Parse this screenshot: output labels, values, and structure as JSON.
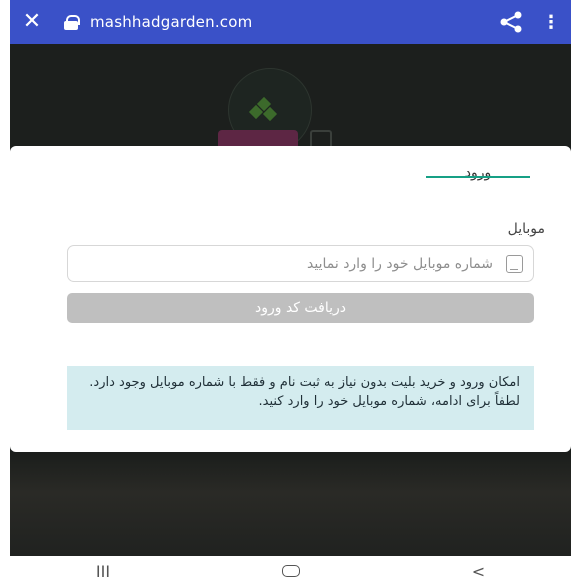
{
  "browser": {
    "url": "mashhadgarden.com",
    "close_glyph": "✕",
    "menu_glyph": "⋮"
  },
  "modal": {
    "tab_label": "ورود",
    "field_label": "موبایل",
    "mobile_placeholder": "شماره موبایل خود را وارد نمایید",
    "submit_label": "دریافت کد ورود",
    "notice_text": "امکان ورود و خرید بلیت بدون نیاز به ثبت نام و فقط با شماره موبایل وجود دارد. لطفاً برای ادامه، شماره موبایل خود را وارد کنید."
  },
  "navbar": {
    "recents_glyph": "III",
    "back_glyph": "<"
  },
  "colors": {
    "browser_bar": "#3a51c8",
    "accent_underline": "#16a085",
    "button_disabled": "#bfbfbf",
    "notice_bg": "#d4ecef"
  }
}
